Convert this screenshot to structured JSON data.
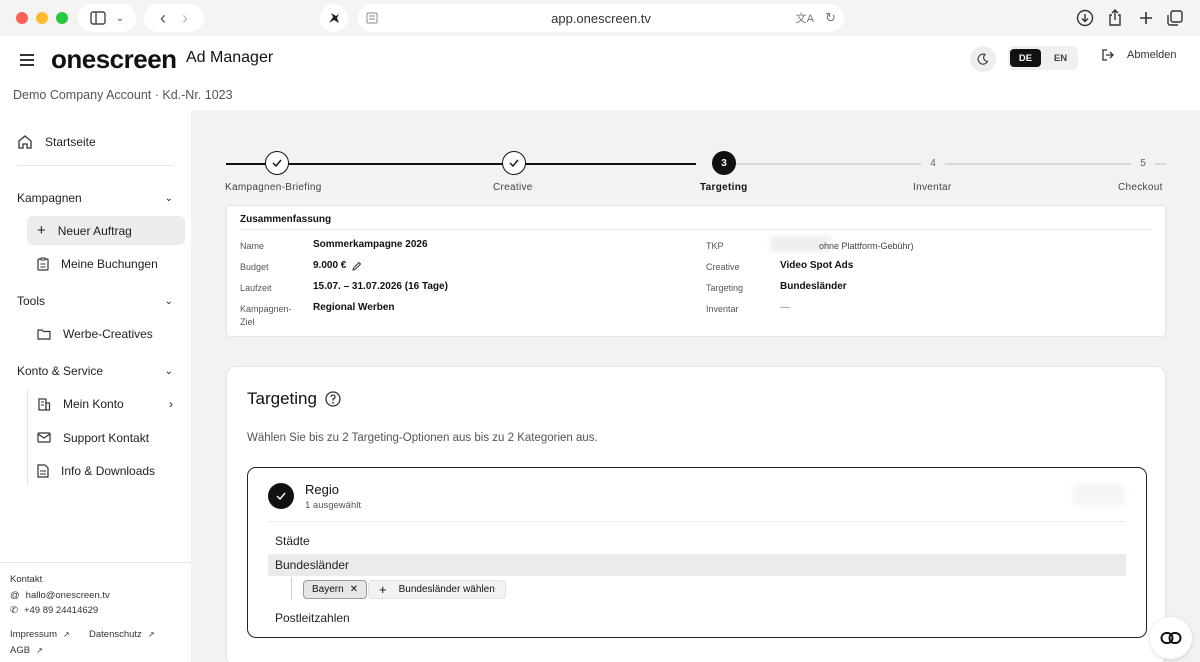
{
  "browser": {
    "url": "app.onescreen.tv"
  },
  "header": {
    "logo": "onescreen",
    "logo_sub": "Ad Manager",
    "account": "Demo Company Account · Kd.-Nr. 1023",
    "lang_de": "DE",
    "lang_en": "EN",
    "logout": "Abmelden"
  },
  "sidebar": {
    "home": "Startseite",
    "sections": [
      {
        "title": "Kampagnen",
        "items": [
          "Neuer Auftrag",
          "Meine Buchungen"
        ]
      },
      {
        "title": "Tools",
        "items": [
          "Werbe-Creatives"
        ]
      },
      {
        "title": "Konto & Service",
        "items": [
          "Mein Konto",
          "Support Kontakt",
          "Info & Downloads"
        ]
      }
    ],
    "contact": {
      "title": "Kontakt",
      "email": "hallo@onescreen.tv",
      "phone": "+49 89 24414629",
      "imprint": "Impressum",
      "privacy": "Datenschutz",
      "terms": "AGB"
    }
  },
  "stepper": {
    "steps": [
      {
        "number": "1",
        "label": "Kampagnen-Briefing",
        "state": "done"
      },
      {
        "number": "2",
        "label": "Creative",
        "state": "done"
      },
      {
        "number": "3",
        "label": "Targeting",
        "state": "current"
      },
      {
        "number": "4",
        "label": "Inventar",
        "state": "future"
      },
      {
        "number": "5",
        "label": "Checkout",
        "state": "future"
      }
    ]
  },
  "summary": {
    "title": "Zusammenfassung",
    "left": [
      {
        "label": "Name",
        "value": "Sommerkampagne 2026"
      },
      {
        "label": "Budget",
        "value": "9.000 €"
      },
      {
        "label": "Laufzeit",
        "value": "15.07. – 31.07.2026 (16 Tage)"
      },
      {
        "label": "Kampagnen-Ziel",
        "value": "Regional Werben"
      }
    ],
    "right": [
      {
        "label": "TKP",
        "value": "ohne Plattform-Gebühr)"
      },
      {
        "label": "Creative",
        "value": "Video Spot Ads"
      },
      {
        "label": "Targeting",
        "value": "Bundesländer"
      },
      {
        "label": "Inventar",
        "value": "—"
      }
    ]
  },
  "targeting": {
    "title": "Targeting",
    "description": "Wählen Sie bis zu 2 Targeting-Optionen aus bis zu 2 Kategorien aus.",
    "category": {
      "title": "Regio",
      "subtitle": "1 ausgewählt",
      "options": [
        "Städte",
        "Bundesländer",
        "Postleitzahlen"
      ],
      "selected_chip": "Bayern",
      "add_chip": "Bundesländer wählen"
    }
  }
}
